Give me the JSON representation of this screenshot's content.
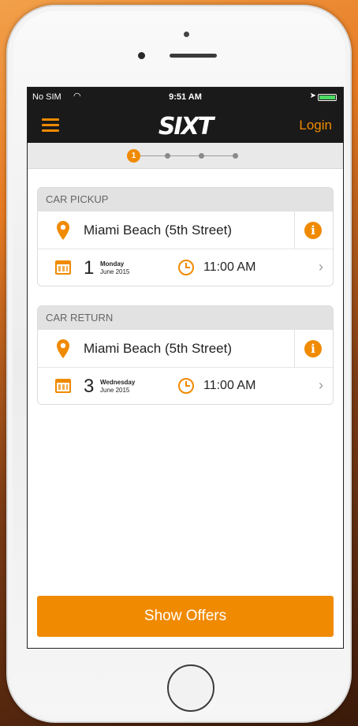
{
  "status_bar": {
    "carrier": "No SIM",
    "time": "9:51 AM"
  },
  "nav": {
    "logo": "SIXT",
    "login_label": "Login"
  },
  "progress": {
    "current_step": "1",
    "total_steps": 4
  },
  "pickup": {
    "header": "CAR PICKUP",
    "location": "Miami Beach (5th Street)",
    "day": "1",
    "weekday": "Monday",
    "month_year": "June 2015",
    "time": "11:00 AM"
  },
  "return": {
    "header": "CAR RETURN",
    "location": "Miami Beach (5th Street)",
    "day": "3",
    "weekday": "Wednesday",
    "month_year": "June 2015",
    "time": "11:00 AM"
  },
  "actions": {
    "show_offers": "Show Offers"
  },
  "colors": {
    "accent": "#f08a00",
    "topbar": "#1a1a1a"
  },
  "icons": {
    "info": "i",
    "chevron": "›"
  }
}
